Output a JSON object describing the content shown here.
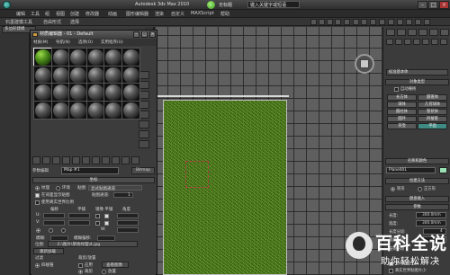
{
  "window": {
    "title_left": "Autodesk 3ds Max  2010",
    "title_right": "无标题",
    "search_placeholder": "键入关键字或短语"
  },
  "menubar": [
    "编辑",
    "工具",
    "组",
    "视图",
    "创建",
    "修改器",
    "动画",
    "图形编辑器",
    "渲染",
    "自定义",
    "MAXScript",
    "帮助"
  ],
  "ribbon": {
    "tabs": [
      "石墨建模工具",
      "自由形式",
      "选择"
    ],
    "sub_label": "多边形建模"
  },
  "material_editor": {
    "title": "材质编辑器 - 01 - Default",
    "menus": [
      "材质(M)",
      "导航(N)",
      "选项(O)",
      "实用程序(U)"
    ],
    "material_name_label": "参数编辑",
    "material_name": "Map #1",
    "material_type_button": "Bitmap",
    "rollouts": {
      "coords": "坐标",
      "noise": "噪波",
      "time": "时间",
      "output": "输出",
      "bitmap_params": "位图参数"
    },
    "coords_fields": {
      "texture": "纹理",
      "environ": "环境",
      "mapping_label": "贴图:",
      "mapping_value": "显式贴图通道",
      "show_map_on_back": "在背面显示贴图",
      "map_channel_label": "贴图通道:",
      "map_channel_value": "1",
      "use_real_world": "使用真实世界比例",
      "offset": "偏移",
      "tiling": "平铺",
      "mirror_tile": "镜像 平铺",
      "angle": "角度",
      "u": "U:",
      "v": "V:",
      "w": "W:",
      "blur": "模糊:",
      "blur_offset": "模糊偏移:"
    },
    "bitmap": {
      "path_label": "位图:",
      "path": "E:\\图片\\草地纹理\\4.jpg",
      "reload": "重新加载",
      "filtering": "过滤",
      "cropping": "裁剪/放置",
      "apply": "应用",
      "view_image": "查看图像",
      "pyramidal": "四棱锥",
      "crop": "裁剪",
      "place": "放置"
    }
  },
  "command_panel": {
    "dropdown": "标准基本体",
    "object_type_header": "对象类型",
    "autogrid": "自动栅格",
    "buttons": [
      [
        "长方体",
        "圆锥体"
      ],
      [
        "球体",
        "几何球体"
      ],
      [
        "圆柱体",
        "管状体"
      ],
      [
        "圆环",
        "四棱锥"
      ],
      [
        "茶壶",
        "平面"
      ]
    ],
    "name_color_header": "名称和颜色",
    "object_name": "Plane001",
    "creation_method_header": "创建方法",
    "creation_methods": [
      "矩形",
      "正方形"
    ],
    "keyboard_entry_header": "键盘输入",
    "params_header": "参数",
    "params": [
      {
        "label": "长度:",
        "value": "300.0mm"
      },
      {
        "label": "宽度:",
        "value": "300.0mm"
      },
      {
        "label": "长度分段:",
        "value": "4"
      },
      {
        "label": "宽度分段:",
        "value": "4"
      }
    ],
    "render_multipliers": "渲染倍增",
    "generate_mapping": "生成贴图坐标",
    "real_world": "真实世界贴图大小"
  },
  "watermark": {
    "title": "百科全说",
    "subtitle": "助你轻松解决"
  }
}
